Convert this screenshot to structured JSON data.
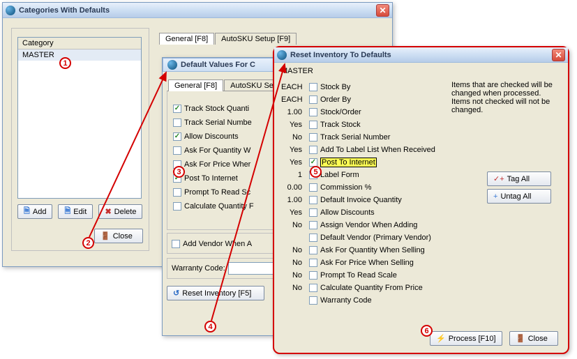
{
  "win1": {
    "title": "Categories With Defaults",
    "list_header": "Category",
    "list_item": "MASTER",
    "btn_add": "Add",
    "btn_edit": "Edit",
    "btn_delete": "Delete",
    "btn_close": "Close",
    "tab_general": "General [F8]",
    "tab_autosku": "AutoSKU Setup [F9]"
  },
  "win2": {
    "title": "Default Values For C",
    "tab_general": "General [F8]",
    "tab_autosku": "AutoSKU Set",
    "checks": [
      {
        "label": "Track Stock Quanti",
        "checked": true
      },
      {
        "label": "Track Serial Numbe",
        "checked": false
      },
      {
        "label": "Allow Discounts",
        "checked": true
      },
      {
        "label": "Ask For Quantity W",
        "checked": false
      },
      {
        "label": "Ask For Price Wher",
        "checked": false
      },
      {
        "label": "Post To Internet",
        "checked": true
      },
      {
        "label": "Prompt To Read Sc",
        "checked": false
      },
      {
        "label": "Calculate Quantity F",
        "checked": false
      }
    ],
    "add_vendor": "Add Vendor When A",
    "warranty_label": "Warranty Code:",
    "btn_reset": "Reset Inventory [F5]"
  },
  "win3": {
    "title": "Reset Inventory To Defaults",
    "master": "MASTER",
    "info": "Items that are checked will be changed when processed. Items not checked will not be changed.",
    "btn_tagall": "Tag All",
    "btn_untagall": "Untag All",
    "btn_process": "Process [F10]",
    "btn_close": "Close",
    "rows": [
      {
        "val": "EACH",
        "label": "Stock By",
        "checked": false
      },
      {
        "val": "EACH",
        "label": "Order By",
        "checked": false
      },
      {
        "val": "1.00",
        "label": "Stock/Order",
        "checked": false
      },
      {
        "val": "Yes",
        "label": "Track Stock",
        "checked": false
      },
      {
        "val": "No",
        "label": "Track Serial Number",
        "checked": false
      },
      {
        "val": "Yes",
        "label": "Add To Label List When Received",
        "checked": false
      },
      {
        "val": "Yes",
        "label": "Post To Internet",
        "checked": true,
        "hl": true
      },
      {
        "val": "1",
        "label": "Label Form",
        "checked": false
      },
      {
        "val": "0.00",
        "label": "Commission %",
        "checked": false
      },
      {
        "val": "1.00",
        "label": "Default Invoice Quantity",
        "checked": false
      },
      {
        "val": "Yes",
        "label": "Allow Discounts",
        "checked": false
      },
      {
        "val": "No",
        "label": "Assign Vendor When Adding",
        "checked": false
      },
      {
        "val": "",
        "label": "Default Vendor (Primary Vendor)",
        "checked": false
      },
      {
        "val": "No",
        "label": "Ask For Quantity When Selling",
        "checked": false
      },
      {
        "val": "No",
        "label": "Ask For Price When Selling",
        "checked": false
      },
      {
        "val": "No",
        "label": "Prompt To Read Scale",
        "checked": false
      },
      {
        "val": "No",
        "label": "Calculate Quantity From Price",
        "checked": false
      },
      {
        "val": "",
        "label": "Warranty Code",
        "checked": false
      }
    ]
  },
  "ann": {
    "1": "1",
    "2": "2",
    "3": "3",
    "4": "4",
    "5": "5",
    "6": "6"
  }
}
